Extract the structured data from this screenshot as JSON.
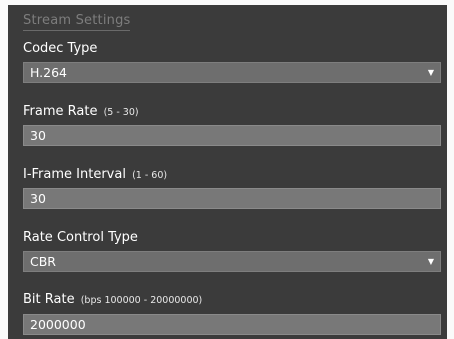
{
  "section": {
    "title": "Stream Settings"
  },
  "codec": {
    "label": "Codec Type",
    "value": "H.264"
  },
  "frame_rate": {
    "label": "Frame Rate",
    "hint": "(5 - 30)",
    "value": "30"
  },
  "iframe_interval": {
    "label": "I-Frame Interval",
    "hint": "(1 - 60)",
    "value": "30"
  },
  "rate_control": {
    "label": "Rate Control Type",
    "value": "CBR"
  },
  "bit_rate": {
    "label": "Bit Rate",
    "hint": "(bps 100000 - 20000000)",
    "value": "2000000"
  },
  "icons": {
    "dropdown": "chevron-down-icon"
  }
}
